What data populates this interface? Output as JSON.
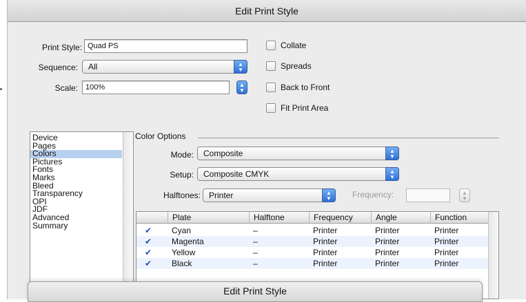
{
  "window": {
    "title": "Edit Print Style"
  },
  "fields": {
    "print_style_label": "Print Style:",
    "print_style_value": "Quad PS",
    "sequence_label": "Sequence:",
    "sequence_value": "All",
    "scale_label": "Scale:",
    "scale_value": "100%"
  },
  "checkboxes": [
    {
      "label": "Collate",
      "checked": false
    },
    {
      "label": "Spreads",
      "checked": false
    },
    {
      "label": "Back to Front",
      "checked": false
    },
    {
      "label": "Fit Print Area",
      "checked": false
    }
  ],
  "sidebar": {
    "items": [
      "Device",
      "Pages",
      "Colors",
      "Pictures",
      "Fonts",
      "Marks",
      "Bleed",
      "Transparency",
      "OPI",
      "JDF",
      "Advanced",
      "Summary"
    ],
    "selected": "Colors"
  },
  "color_options": {
    "group_title": "Color Options",
    "mode_label": "Mode:",
    "mode_value": "Composite",
    "setup_label": "Setup:",
    "setup_value": "Composite CMYK",
    "halftones_label": "Halftones:",
    "halftones_value": "Printer",
    "frequency_label": "Frequency:",
    "frequency_value": ""
  },
  "table": {
    "columns": [
      "Plate",
      "Halftone",
      "Frequency",
      "Angle",
      "Function"
    ],
    "rows": [
      {
        "checked": true,
        "plate": "Cyan",
        "halftone": "–",
        "frequency": "Printer",
        "angle": "Printer",
        "function": "Printer"
      },
      {
        "checked": true,
        "plate": "Magenta",
        "halftone": "–",
        "frequency": "Printer",
        "angle": "Printer",
        "function": "Printer"
      },
      {
        "checked": true,
        "plate": "Yellow",
        "halftone": "–",
        "frequency": "Printer",
        "angle": "Printer",
        "function": "Printer"
      },
      {
        "checked": true,
        "plate": "Black",
        "halftone": "–",
        "frequency": "Printer",
        "angle": "Printer",
        "function": "Printer"
      }
    ]
  },
  "sheet": {
    "title": "Edit Print Style"
  },
  "icons": {
    "popup": "up-down-arrows-icon",
    "check": "checkmark-icon"
  }
}
